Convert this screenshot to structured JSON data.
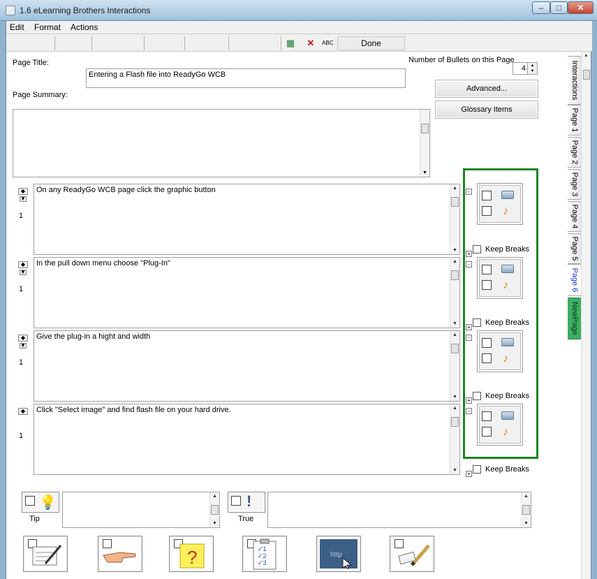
{
  "window": {
    "title": "1.6 eLearning Brothers Interactions"
  },
  "menu": [
    "Edit",
    "Format",
    "Actions"
  ],
  "toolbar": {
    "done_label": "Done"
  },
  "page": {
    "title_label": "Page Title:",
    "title_value": "Entering a Flash file into ReadyGo WCB",
    "summary_label": "Page Summary:",
    "summary_value": "",
    "bullets_label": "Number of Bullets on this Page",
    "bullets_count": "4",
    "advanced_label": "Advanced...",
    "glossary_label": "Glossary Items"
  },
  "tabs": [
    "Interactions",
    "Page 1",
    "Page 2",
    "Page 3",
    "Page 4",
    "Page 5",
    "Page 6",
    "NewPage"
  ],
  "bullets": [
    {
      "number": "1",
      "text": "On any ReadyGo WCB page click the graphic button",
      "keep_breaks": "Keep Breaks"
    },
    {
      "number": "1",
      "text": "In the pull down menu choose \"Plug-In\"",
      "keep_breaks": "Keep Breaks"
    },
    {
      "number": "1",
      "text": "Give the plug-in a hight and width",
      "keep_breaks": "Keep Breaks"
    },
    {
      "number": "1",
      "text": "Click \"Select image\" and find flash file on your hard drive.",
      "keep_breaks": "Keep Breaks"
    }
  ],
  "bottom": {
    "tip_label": "Tip",
    "true_label": "True"
  },
  "colors": {
    "highlight_box": "#19861f",
    "new_page_tab": "#3cae63",
    "active_tab_text": "#1a33cc"
  },
  "icons": {
    "toolbar": [
      "spellcheck-icon",
      "delete-icon",
      "abc-icon"
    ],
    "bottom_tiles": [
      "notepad-icon",
      "pointing-hand-icon",
      "question-note-icon",
      "checklist-icon",
      "web-link-icon",
      "eraser-pencil-icon"
    ]
  }
}
